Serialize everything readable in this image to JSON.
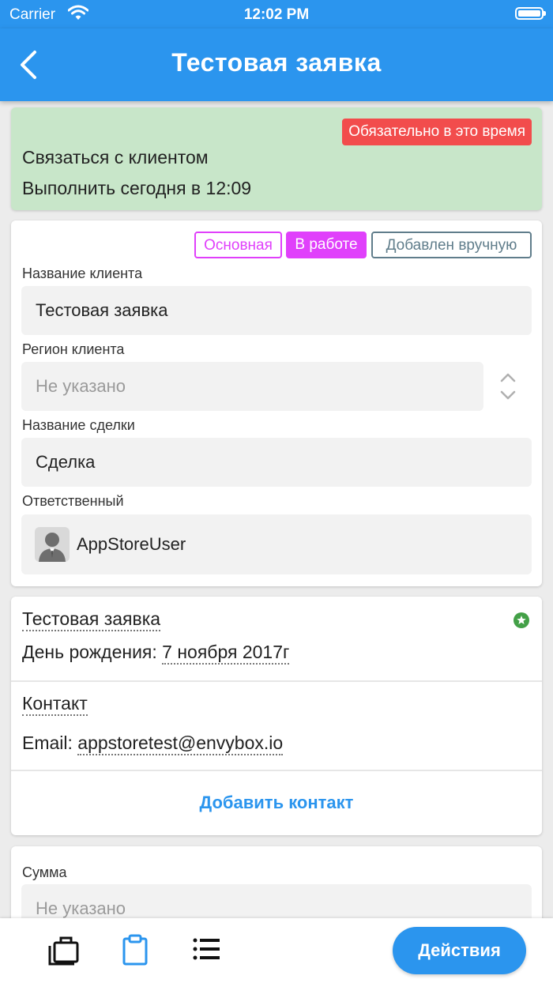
{
  "status_bar": {
    "carrier": "Carrier",
    "time": "12:02 PM"
  },
  "nav": {
    "title": "Тестовая заявка"
  },
  "reminder": {
    "badge": "Обязательно в это время",
    "task": "Связаться с клиентом",
    "due": "Выполнить сегодня в 12:09"
  },
  "client_card": {
    "tags": [
      "Основная",
      "В работе",
      "Добавлен вручную"
    ],
    "client_name_label": "Название клиента",
    "client_name_value": "Тестовая заявка",
    "region_label": "Регион клиента",
    "region_placeholder": "Не указано",
    "deal_label": "Название сделки",
    "deal_value": "Сделка",
    "responsible_label": "Ответственный",
    "responsible_value": "AppStoreUser"
  },
  "contact_card": {
    "client_title": "Тестовая заявка",
    "birthday_label": "День рождения:",
    "birthday_value": "7 ноября 2017г",
    "contact_title": "Контакт",
    "email_label": "Email:",
    "email_value": "appstoretest@envybox.io",
    "add_contact": "Добавить контакт"
  },
  "amount_card": {
    "label": "Сумма",
    "placeholder": "Не указано"
  },
  "tab_bar": {
    "icons": [
      "briefcase-icon",
      "clipboard-icon",
      "list-icon"
    ],
    "actions_label": "Действия"
  },
  "colors": {
    "primary": "#2b95ee",
    "reminder_bg": "#c8e6c9",
    "urgent_badge": "#f24c4c",
    "tag_main": "#e040fb",
    "tag_in_work": "#e040fb",
    "tag_manual": "#607d8b",
    "star": "#43a047"
  }
}
